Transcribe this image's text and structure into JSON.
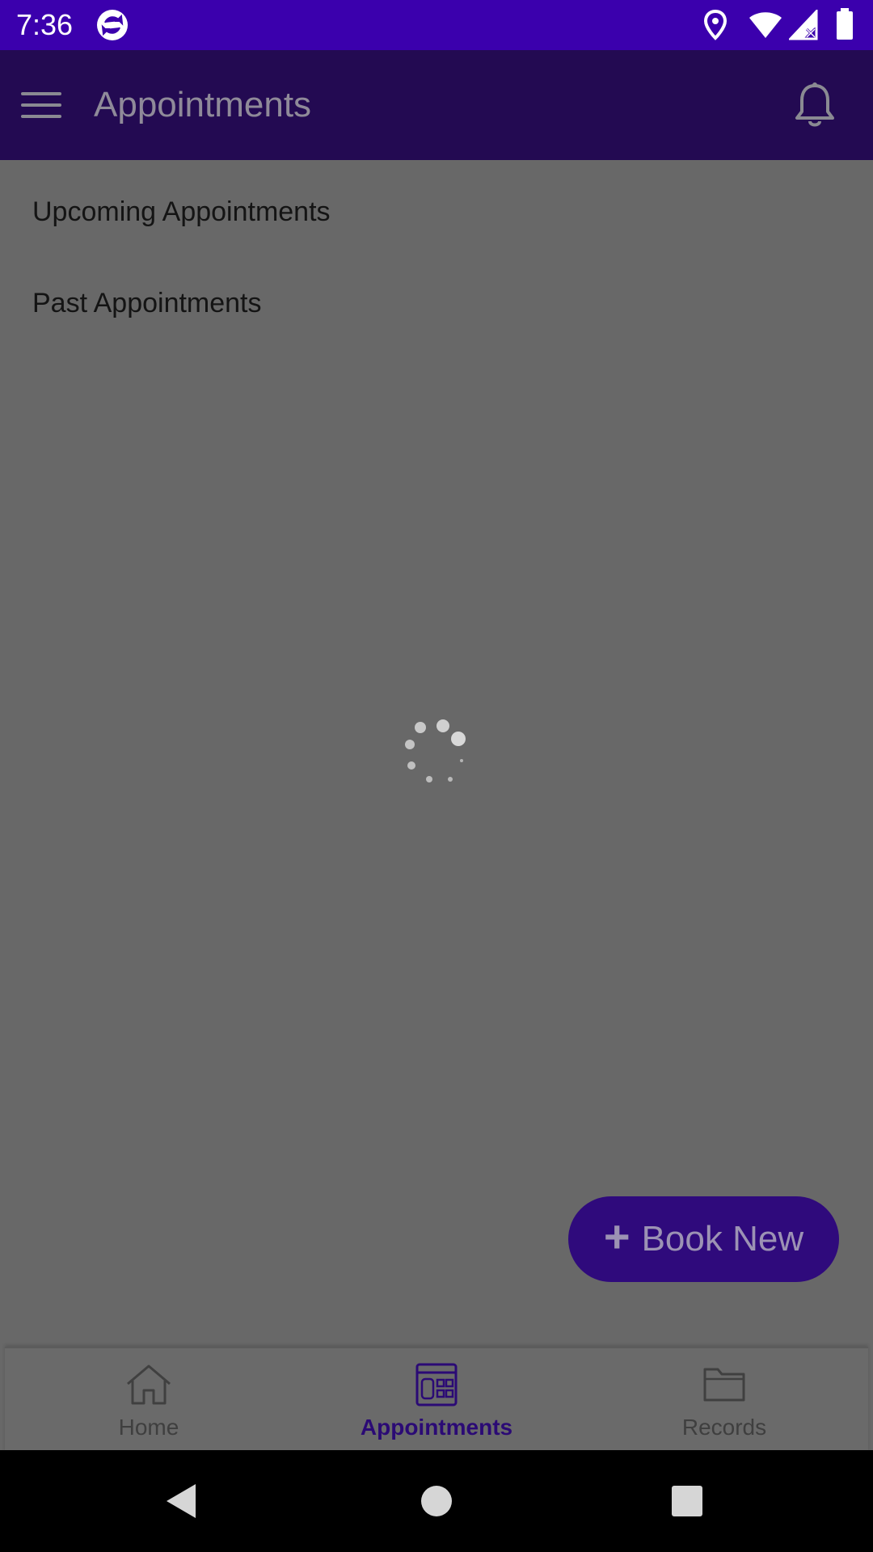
{
  "status_bar": {
    "time": "7:36",
    "icons": [
      "sync-app-icon",
      "location-icon",
      "wifi-icon",
      "signal-icon",
      "battery-icon"
    ],
    "background": "#3b00ad"
  },
  "app_bar": {
    "title": "Appointments",
    "menu_icon": "hamburger-menu-icon",
    "action_icon": "bell-icon",
    "background": "#230a52"
  },
  "list": {
    "items": [
      {
        "label": "Upcoming Appointments"
      },
      {
        "label": "Past Appointments"
      }
    ]
  },
  "loading": {
    "icon": "loading-spinner-icon"
  },
  "fab": {
    "icon": "plus-icon",
    "label": "Book New",
    "background": "#2f0a7c"
  },
  "bottom_nav": {
    "items": [
      {
        "label": "Home",
        "icon": "home-icon",
        "active": false
      },
      {
        "label": "Appointments",
        "icon": "calendar-icon",
        "active": true
      },
      {
        "label": "Records",
        "icon": "folder-icon",
        "active": false
      }
    ],
    "active_color": "#2b0a75"
  },
  "system_nav": {
    "buttons": [
      "back-icon",
      "home-circle-icon",
      "recents-icon"
    ]
  }
}
